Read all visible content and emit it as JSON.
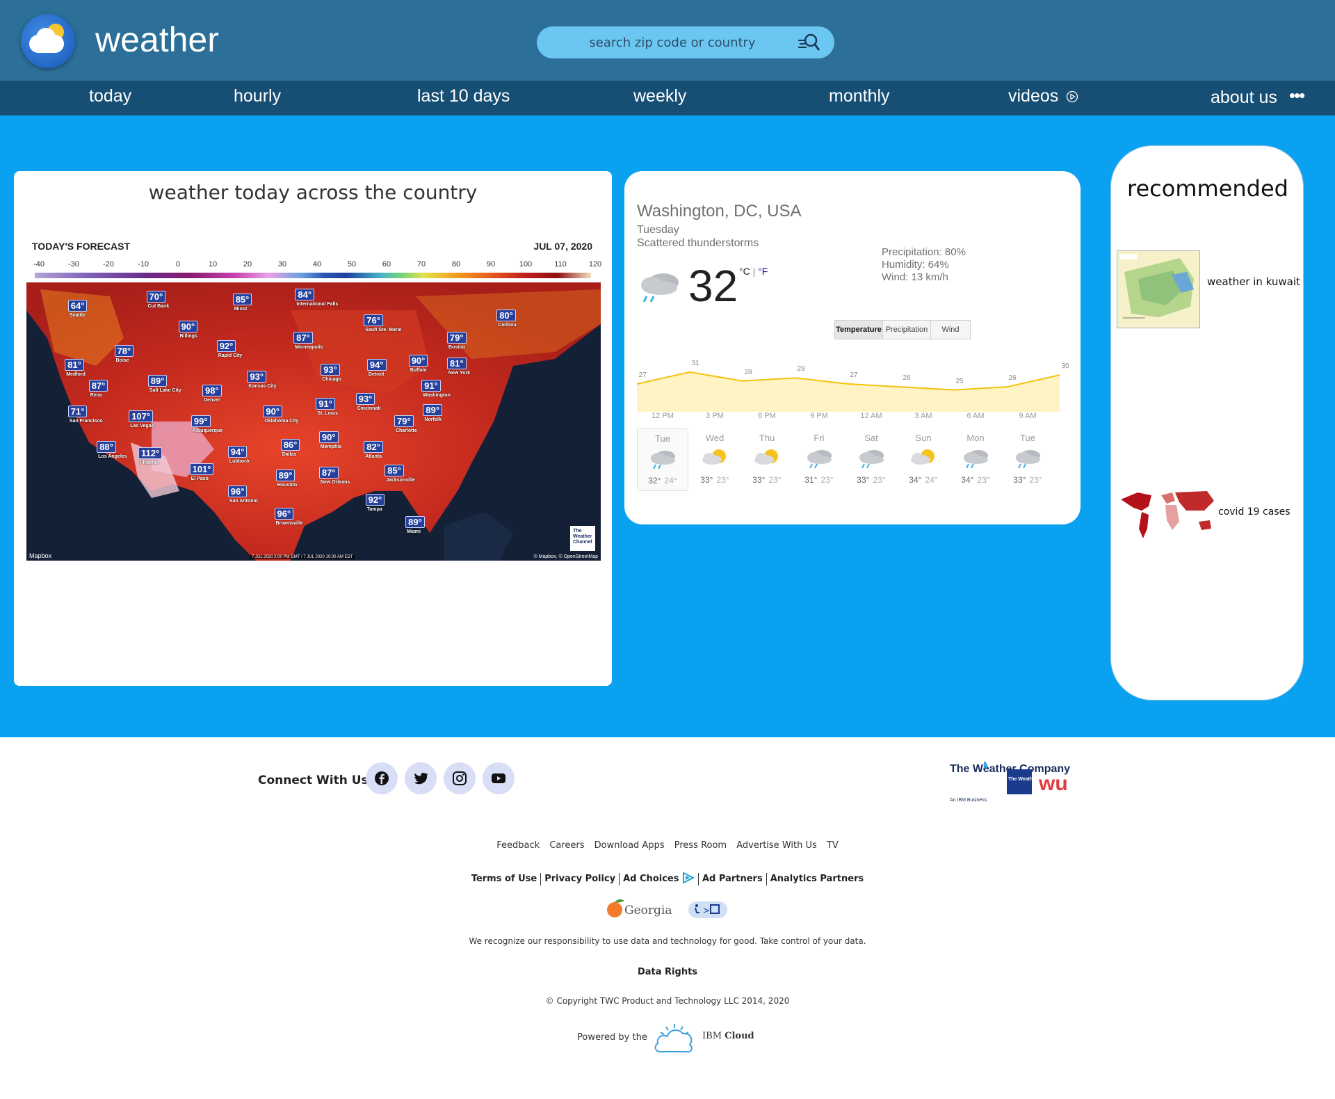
{
  "header": {
    "title": "weather",
    "search": {
      "placeholder": "search zip code or country"
    }
  },
  "nav": {
    "items": [
      "today",
      "hourly",
      "last 10 days",
      "weekly",
      "monthly",
      "videos",
      "about us"
    ]
  },
  "map_card": {
    "title": "weather today across the country",
    "forecast_label": "TODAY'S FORECAST",
    "date": "JUL 07, 2020",
    "scale": [
      "-40",
      "-30",
      "-20",
      "-10",
      "0",
      "10",
      "20",
      "30",
      "40",
      "50",
      "60",
      "70",
      "80",
      "90",
      "100",
      "110",
      "120"
    ],
    "cities": [
      {
        "temp": "64°",
        "name": "Seattle"
      },
      {
        "temp": "70°",
        "name": "Cut Bank"
      },
      {
        "temp": "85°",
        "name": "Minot"
      },
      {
        "temp": "84°",
        "name": "International Falls"
      },
      {
        "temp": "76°",
        "name": "Sault Ste. Marie"
      },
      {
        "temp": "80°",
        "name": "Caribou"
      },
      {
        "temp": "90°",
        "name": "Billings"
      },
      {
        "temp": "87°",
        "name": "Minneapolis"
      },
      {
        "temp": "79°",
        "name": "Boston"
      },
      {
        "temp": "78°",
        "name": "Boise"
      },
      {
        "temp": "92°",
        "name": "Rapid City"
      },
      {
        "temp": "81°",
        "name": "Medford"
      },
      {
        "temp": "93°",
        "name": "Chicago"
      },
      {
        "temp": "94°",
        "name": "Detroit"
      },
      {
        "temp": "90°",
        "name": "Buffalo"
      },
      {
        "temp": "81°",
        "name": "New York"
      },
      {
        "temp": "87°",
        "name": "Reno"
      },
      {
        "temp": "89°",
        "name": "Salt Lake City"
      },
      {
        "temp": "93°",
        "name": "Kansas City"
      },
      {
        "temp": "91°",
        "name": "Washington"
      },
      {
        "temp": "98°",
        "name": "Denver"
      },
      {
        "temp": "93°",
        "name": "Cincinnati"
      },
      {
        "temp": "71°",
        "name": "San Francisco"
      },
      {
        "temp": "107°",
        "name": "Las Vegas"
      },
      {
        "temp": "90°",
        "name": "Oklahoma City"
      },
      {
        "temp": "91°",
        "name": "St. Louis"
      },
      {
        "temp": "89°",
        "name": "Norfolk"
      },
      {
        "temp": "99°",
        "name": "Albuquerque"
      },
      {
        "temp": "79°",
        "name": "Charlotte"
      },
      {
        "temp": "90°",
        "name": "Memphis"
      },
      {
        "temp": "88°",
        "name": "Los Angeles"
      },
      {
        "temp": "112°",
        "name": "Phoenix"
      },
      {
        "temp": "86°",
        "name": "Dallas"
      },
      {
        "temp": "94°",
        "name": "Lubbock"
      },
      {
        "temp": "82°",
        "name": "Atlanta"
      },
      {
        "temp": "101°",
        "name": "El Paso"
      },
      {
        "temp": "89°",
        "name": "Houston"
      },
      {
        "temp": "87°",
        "name": "New Orleans"
      },
      {
        "temp": "85°",
        "name": "Jacksonville"
      },
      {
        "temp": "96°",
        "name": "San Antonio"
      },
      {
        "temp": "92°",
        "name": "Tampa"
      },
      {
        "temp": "96°",
        "name": "Brownsville"
      },
      {
        "temp": "89°",
        "name": "Miami"
      }
    ],
    "mapbox_label": "Mapbox",
    "timestamp": "7 JUL 2020 2:00 PM GMT / 7 JUL 2020 10:00 AM EDT",
    "credit": "© Mapbox, © OpenStreetMap",
    "twc_logo": "The Weather Channel"
  },
  "weather": {
    "location": "Washington, DC, USA",
    "day": "Tuesday",
    "condition": "Scattered thunderstorms",
    "temp": "32",
    "unit_c": "°C",
    "unit_sep": "|",
    "unit_f": "°F",
    "precipitation": "Precipitation: 80%",
    "humidity": "Humidity: 64%",
    "wind": "Wind: 13 km/h",
    "tabs": [
      "Temperature",
      "Precipitation",
      "Wind"
    ],
    "active_tab": "Temperature",
    "hourly_temps": [
      27,
      31,
      28,
      29,
      27,
      26,
      25,
      26,
      30
    ],
    "hourly_labels": [
      "27",
      "31",
      "28",
      "29",
      "27",
      "26",
      "25",
      "26",
      "30"
    ],
    "hours": [
      "12 PM",
      "3 PM",
      "6 PM",
      "9 PM",
      "12 AM",
      "3 AM",
      "6 AM",
      "9 AM"
    ],
    "days": [
      {
        "name": "Tue",
        "hi": "32°",
        "lo": "24°",
        "icon": "thunderstorm-icon"
      },
      {
        "name": "Wed",
        "hi": "33°",
        "lo": "23°",
        "icon": "partly-sunny-icon"
      },
      {
        "name": "Thu",
        "hi": "33°",
        "lo": "23°",
        "icon": "partly-sunny-icon"
      },
      {
        "name": "Fri",
        "hi": "31°",
        "lo": "23°",
        "icon": "thunderstorm-icon"
      },
      {
        "name": "Sat",
        "hi": "33°",
        "lo": "23°",
        "icon": "thunderstorm-icon"
      },
      {
        "name": "Sun",
        "hi": "34°",
        "lo": "24°",
        "icon": "partly-sunny-icon"
      },
      {
        "name": "Mon",
        "hi": "34°",
        "lo": "23°",
        "icon": "thunderstorm-icon"
      },
      {
        "name": "Tue",
        "hi": "33°",
        "lo": "23°",
        "icon": "thunderstorm-icon"
      }
    ],
    "colors": {
      "graph_line": "#f4c20d",
      "graph_fill": "#fff3c4"
    }
  },
  "recommended": {
    "title": "recommended",
    "items": [
      {
        "label": "weather in kuwait",
        "thumb": "kuwait-map-image"
      },
      {
        "label": "covid 19 cases",
        "thumb": "world-map-image"
      }
    ]
  },
  "footer": {
    "connect_label": "Connect With Us",
    "social": [
      "facebook-icon",
      "twitter-icon",
      "instagram-icon",
      "youtube-icon"
    ],
    "links": [
      "Feedback",
      "Careers",
      "Download Apps",
      "Press Room",
      "Advertise With Us",
      "TV"
    ],
    "legal": [
      "Terms of Use",
      "Privacy Policy",
      "Ad Choices",
      "Ad Partners",
      "Analytics Partners"
    ],
    "georgia": "Georgia",
    "responsibility": "We recognize our responsibility to use data and technology for good. Take control of your data.",
    "data_rights": "Data Rights",
    "copyright": "© Copyright TWC Product and Technology LLC 2014, 2020",
    "powered_by": "Powered by the",
    "ibm": "IBM",
    "cloud": "Cloud",
    "logo_twc": "The Weather Company",
    "logo_twc_sub": "An IBM Business",
    "logo_channel": "The Weather Channel",
    "logo_wu": "wu"
  },
  "theme": {
    "header_bg": "#2c6f98",
    "nav_bg": "#174e73",
    "main_bg": "#0aa2f0",
    "search_bg": "#6cc6f2"
  }
}
